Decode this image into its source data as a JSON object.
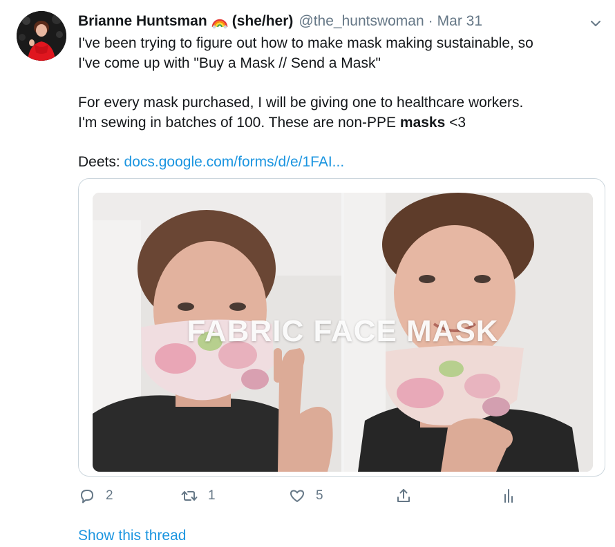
{
  "tweet": {
    "author_name": "Brianne Huntsman",
    "author_pronouns": "(she/her)",
    "handle": "@the_huntswoman",
    "separator": "·",
    "date": "Mar 31",
    "text": {
      "line1": "I've been trying to figure out how to make mask making sustainable, so",
      "line2": "I've come up with \"Buy a Mask // Send a Mask\"",
      "line3": "For every mask purchased, I will be giving one to healthcare workers.",
      "line4_start": "I'm sewing in batches of 100.  These are non-PPE ",
      "line4_bold": "masks",
      "line4_end": " <3",
      "line5_start": "Deets: ",
      "line5_link": "docs.google.com/forms/d/e/1FAI..."
    },
    "media": {
      "overlay_title": "FABRIC FACE MASK"
    },
    "actions": {
      "reply_count": "2",
      "retweet_count": "1",
      "like_count": "5"
    },
    "show_thread": "Show this thread"
  },
  "colors": {
    "link": "#1b95e0",
    "secondary_text": "#657786",
    "border": "#ccd6dd"
  },
  "icons": [
    "rainbow-emoji",
    "chevron-down-icon",
    "reply-icon",
    "retweet-icon",
    "like-icon",
    "share-icon",
    "analytics-icon"
  ]
}
